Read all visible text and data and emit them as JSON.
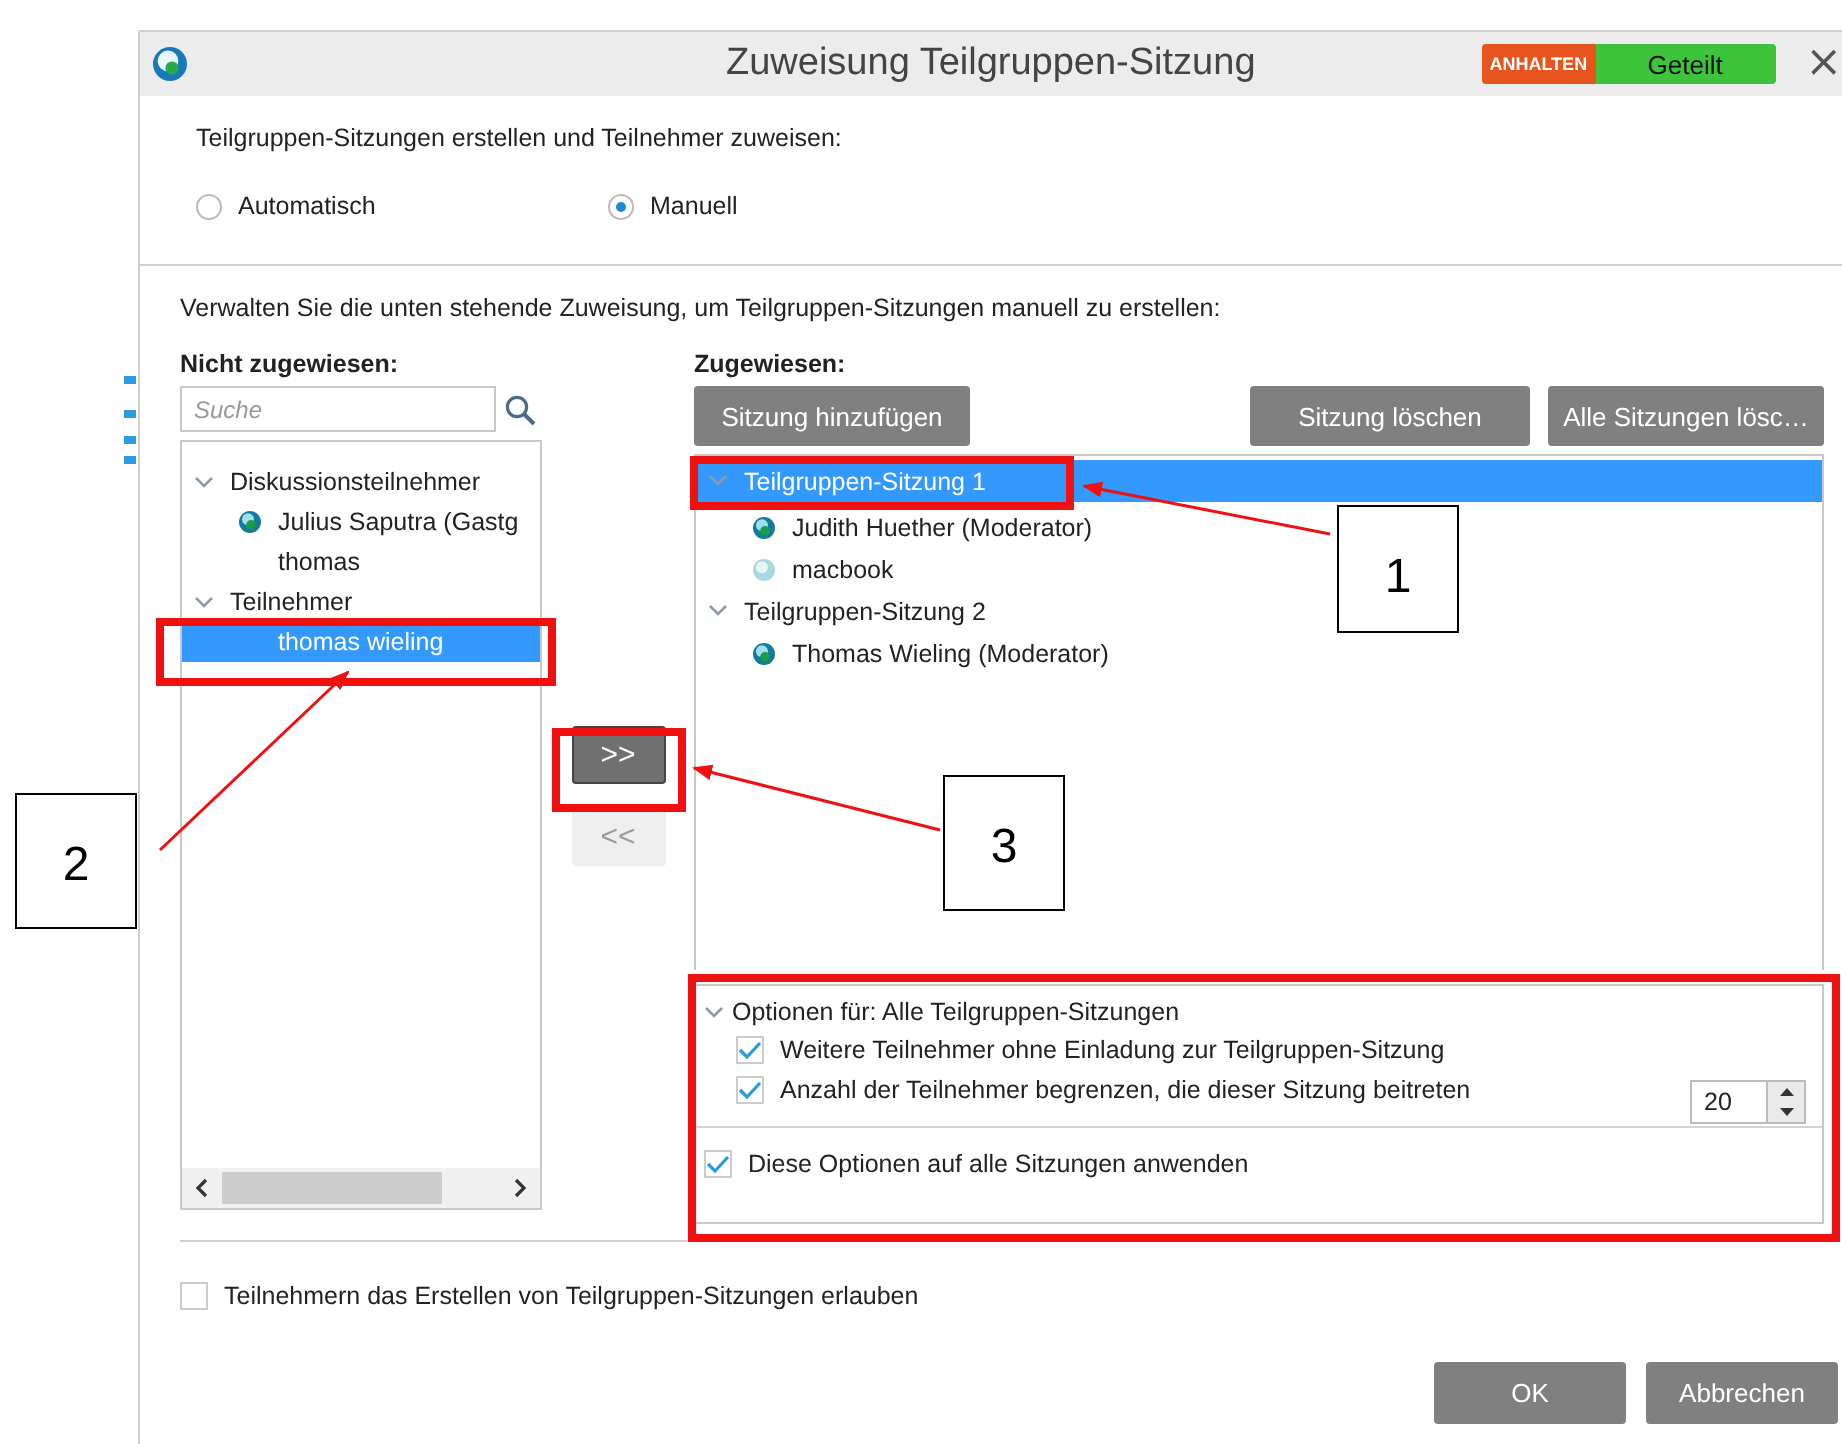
{
  "window": {
    "title": "Zuweisung Teilgruppen-Sitzung",
    "badges": [
      {
        "label": "ANHALTEN",
        "color": "#e8541e"
      },
      {
        "label": "Geteilt",
        "color": "#3dc43b"
      }
    ],
    "close": "×"
  },
  "intro": "Teilgruppen-Sitzungen erstellen und Teilnehmer zuweisen:",
  "radios": [
    {
      "label": "Automatisch",
      "selected": false
    },
    {
      "label": "Manuell",
      "selected": true
    }
  ],
  "instructions": "Verwalten Sie die unten stehende Zuweisung, um Teilgruppen-Sitzungen manuell zu erstellen:",
  "unassigned": {
    "heading": "Nicht zugewiesen:",
    "search": {
      "placeholder": "Suche"
    },
    "tree": [
      {
        "label": "Diskussionsteilnehmer",
        "expanded": true,
        "selected": false,
        "children": [
          {
            "label": "Julius Saputra (Gastg",
            "kind": "globe",
            "selected": false
          },
          {
            "label": "thomas",
            "kind": "plain",
            "selected": false
          }
        ]
      },
      {
        "label": "Teilnehmer",
        "expanded": true,
        "selected": false,
        "children": [
          {
            "label": "thomas wieling",
            "kind": "plain",
            "selected": true
          }
        ]
      }
    ]
  },
  "move_buttons": [
    {
      "label": ">>",
      "disabled": false
    },
    {
      "label": "<<",
      "disabled": true
    }
  ],
  "assigned": {
    "heading": "Zugewiesen:",
    "buttons": [
      "Sitzung hinzufügen",
      "Sitzung löschen",
      "Alle Sitzungen lösc…"
    ],
    "tree": [
      {
        "label": "Teilgruppen-Sitzung 1",
        "expanded": true,
        "selected": true,
        "children": [
          {
            "label": "Judith Huether (Moderator)",
            "kind": "globe",
            "selected": false
          },
          {
            "label": "macbook",
            "kind": "pale-globe",
            "selected": false
          }
        ]
      },
      {
        "label": "Teilgruppen-Sitzung 2",
        "expanded": true,
        "selected": false,
        "children": [
          {
            "label": "Thomas Wieling (Moderator)",
            "kind": "globe",
            "selected": false
          }
        ]
      }
    ]
  },
  "options": {
    "title": "Optionen für: Alle Teilgruppen-Sitzungen",
    "expanded": true,
    "items": [
      {
        "label": "Weitere Teilnehmer ohne Einladung zur Teilgruppen-Sitzung",
        "checked": true
      },
      {
        "label": "Anzahl der Teilnehmer begrenzen, die dieser Sitzung beitreten",
        "checked": true,
        "value": "20"
      }
    ],
    "apply": {
      "label": "Diese Optionen auf alle Sitzungen anwenden",
      "checked": true
    }
  },
  "allow_create": {
    "label": "Teilnehmern das Erstellen von Teilgruppen-Sitzungen erlauben",
    "checked": false
  },
  "footer_buttons": [
    "OK",
    "Abbrechen"
  ],
  "callouts": [
    "1",
    "2",
    "3"
  ]
}
